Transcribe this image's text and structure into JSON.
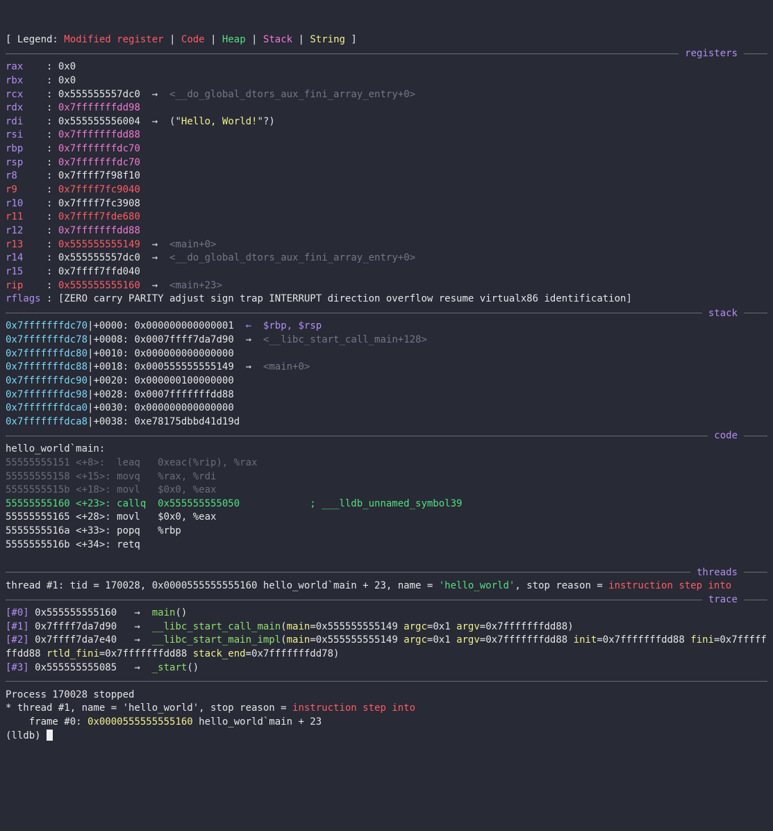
{
  "legend": {
    "prefix": "[ Legend: ",
    "modified": "Modified register",
    "sep": " | ",
    "code": "Code",
    "heap": "Heap",
    "stack": "Stack",
    "string": "String",
    "suffix": " ]"
  },
  "sections": {
    "registers": "registers",
    "stack": "stack",
    "code": "code",
    "threads": "threads",
    "trace": "trace"
  },
  "registers": [
    {
      "name": "rax",
      "value": "0x0",
      "value_style": "plain",
      "arrow": "",
      "target": "",
      "target_style": ""
    },
    {
      "name": "rbx",
      "value": "0x0",
      "value_style": "plain",
      "arrow": "",
      "target": "",
      "target_style": ""
    },
    {
      "name": "rcx",
      "value": "0x555555557dc0",
      "value_style": "plain",
      "arrow": "→",
      "target": "<__do_global_dtors_aux_fini_array_entry+0>",
      "target_style": "gray"
    },
    {
      "name": "rdx",
      "value": "0x7fffffffdd98",
      "value_style": "pink",
      "arrow": "",
      "target": "",
      "target_style": ""
    },
    {
      "name": "rdi",
      "value": "0x555555556004",
      "value_style": "plain",
      "arrow": "→",
      "target": "(\"Hello, World!\"?)",
      "target_style": "string"
    },
    {
      "name": "rsi",
      "value": "0x7fffffffdd88",
      "value_style": "pink",
      "arrow": "",
      "target": "",
      "target_style": ""
    },
    {
      "name": "rbp",
      "value": "0x7fffffffdc70",
      "value_style": "pink",
      "arrow": "",
      "target": "",
      "target_style": ""
    },
    {
      "name": "rsp",
      "value": "0x7fffffffdc70",
      "value_style": "pink",
      "arrow": "",
      "target": "",
      "target_style": ""
    },
    {
      "name": "r8",
      "value": "0x7ffff7f98f10",
      "value_style": "plain",
      "arrow": "",
      "target": "",
      "target_style": ""
    },
    {
      "name": "r9",
      "value": "0x7ffff7fc9040",
      "value_style": "red",
      "arrow": "",
      "target": "",
      "target_style": ""
    },
    {
      "name": "r10",
      "value": "0x7ffff7fc3908",
      "value_style": "plain",
      "arrow": "",
      "target": "",
      "target_style": ""
    },
    {
      "name": "r11",
      "value": "0x7ffff7fde680",
      "value_style": "red",
      "arrow": "",
      "target": "",
      "target_style": ""
    },
    {
      "name": "r12",
      "value": "0x7fffffffdd88",
      "value_style": "pink",
      "arrow": "",
      "target": "",
      "target_style": ""
    },
    {
      "name": "r13",
      "value": "0x555555555149",
      "value_style": "red",
      "arrow": "→",
      "target": "<main+0>",
      "target_style": "gray"
    },
    {
      "name": "r14",
      "value": "0x555555557dc0",
      "value_style": "plain",
      "arrow": "→",
      "target": "<__do_global_dtors_aux_fini_array_entry+0>",
      "target_style": "gray"
    },
    {
      "name": "r15",
      "value": "0x7ffff7ffd040",
      "value_style": "plain",
      "arrow": "",
      "target": "",
      "target_style": ""
    },
    {
      "name": "rip",
      "value": "0x555555555160",
      "value_style": "red",
      "arrow": "→",
      "target": "<main+23>",
      "target_style": "gray"
    }
  ],
  "rflags": {
    "name": "rflags",
    "value": "[ZERO carry PARITY adjust sign trap INTERRUPT direction overflow resume virtualx86 identification]"
  },
  "stack": [
    {
      "addr": "0x7fffffffdc70",
      "offset": "|+0000: ",
      "value": "0x000000000000001",
      "note_arrow": "←",
      "note": "$rbp, $rsp",
      "note_style": "purple"
    },
    {
      "addr": "0x7fffffffdc78",
      "offset": "|+0008: ",
      "value": "0x0007ffff7da7d90",
      "note_arrow": "→",
      "note": "<__libc_start_call_main+128>",
      "note_style": "gray"
    },
    {
      "addr": "0x7fffffffdc80",
      "offset": "|+0010: ",
      "value": "0x000000000000000",
      "note_arrow": "",
      "note": "",
      "note_style": ""
    },
    {
      "addr": "0x7fffffffdc88",
      "offset": "|+0018: ",
      "value": "0x000555555555149",
      "note_arrow": "→",
      "note": "<main+0>",
      "note_style": "gray"
    },
    {
      "addr": "0x7fffffffdc90",
      "offset": "|+0020: ",
      "value": "0x000000100000000",
      "note_arrow": "",
      "note": "",
      "note_style": ""
    },
    {
      "addr": "0x7fffffffdc98",
      "offset": "|+0028: ",
      "value": "0x0007fffffffdd88",
      "note_arrow": "",
      "note": "",
      "note_style": ""
    },
    {
      "addr": "0x7fffffffdca0",
      "offset": "|+0030: ",
      "value": "0x000000000000000",
      "note_arrow": "",
      "note": "",
      "note_style": ""
    },
    {
      "addr": "0x7fffffffdca8",
      "offset": "|+0038: ",
      "value": "0xe78175dbbd41d19d",
      "note_arrow": "",
      "note": "",
      "note_style": ""
    }
  ],
  "code": {
    "function": "hello_world`main:",
    "lines": [
      {
        "text": "55555555151 <+8>:  leaq   0xeac(%rip), %rax",
        "style": "dim"
      },
      {
        "text": "55555555158 <+15>: movq   %rax, %rdi",
        "style": "dim"
      },
      {
        "text": "5555555515b <+18>: movl   $0x0, %eax",
        "style": "dim"
      },
      {
        "text": "55555555160 <+23>: callq  0x555555555050            ; ___lldb_unnamed_symbol39",
        "style": "green"
      },
      {
        "text": "55555555165 <+28>: movl   $0x0, %eax",
        "style": "bright"
      },
      {
        "text": "5555555516a <+33>: popq   %rbp",
        "style": "bright"
      },
      {
        "text": "5555555516b <+34>: retq",
        "style": "bright"
      }
    ]
  },
  "threads": {
    "prefix": "thread #1: tid = 170028, 0x0000555555555160 hello_world`main + 23, name = ",
    "name": "'hello_world'",
    "mid": ", stop reason = ",
    "reason": "instruction step into"
  },
  "trace": {
    "frame0": {
      "idx": "[#0]",
      "addr": " 0x555555555160   →  ",
      "fn": "main",
      "rest": "()"
    },
    "frame1": {
      "idx": "[#1]",
      "addr": " 0x7ffff7da7d90   →  ",
      "fn": "__libc_start_call_main",
      "open": "(",
      "a1k": "main",
      "a1v": "=0x555555555149 ",
      "a2k": "argc",
      "a2v": "=0x1 ",
      "a3k": "argv",
      "a3v": "=0x7fffffffdd88)"
    },
    "frame2": {
      "idx": "[#2]",
      "addr": " 0x7ffff7da7e40   →  ",
      "fn": "__libc_start_main_impl",
      "open": "(",
      "a1k": "main",
      "a1v": "=0x555555555149 ",
      "a2k": "argc",
      "a2v": "=0x1 ",
      "a3k": "argv",
      "a3v": "=0x7fffffffdd88 ",
      "a4k": "init",
      "a4v": "=0x7fffffffdd88 ",
      "a5k": "fini",
      "a5v": "=0x7fffffffdd88 ",
      "a6k": "rtld_fini",
      "a6v": "=0x7fffffffdd88 ",
      "a7k": "stack_end",
      "a7v": "=0x7fffffffdd78)"
    },
    "frame3": {
      "idx": "[#3]",
      "addr": " 0x555555555085   →  ",
      "fn": "_start",
      "rest": "()"
    }
  },
  "console": {
    "process": "Process 170028 stopped",
    "thread_prefix": "* thread #1, name = 'hello_world', stop reason = ",
    "thread_reason": "instruction step into",
    "frame_prefix": "    frame #0: ",
    "frame_addr": "0x0000555555555160",
    "frame_rest": " hello_world`main + 23",
    "prompt": "(lldb) "
  }
}
